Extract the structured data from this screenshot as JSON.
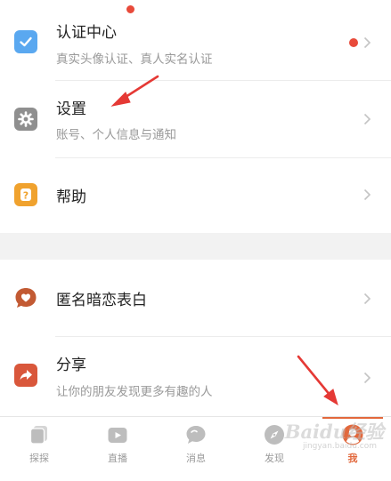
{
  "colors": {
    "accent": "#e2683c",
    "badge_red": "#e84a3a",
    "annotation_red": "#e53935"
  },
  "menu": {
    "certification": {
      "title": "认证中心",
      "subtitle": "真实头像认证、真人实名认证",
      "icon": "checkbox-icon"
    },
    "settings": {
      "title": "设置",
      "subtitle": "账号、个人信息与通知",
      "icon": "gear-icon"
    },
    "help": {
      "title": "帮助",
      "icon": "question-icon"
    },
    "anonymous_confession": {
      "title": "匿名暗恋表白",
      "icon": "heart-bubble-icon"
    },
    "share": {
      "title": "分享",
      "subtitle": "让你的朋友发现更多有趣的人",
      "icon": "share-icon"
    }
  },
  "tabbar": {
    "items": [
      {
        "label": "探探",
        "icon": "cards-icon"
      },
      {
        "label": "直播",
        "icon": "tv-icon"
      },
      {
        "label": "消息",
        "icon": "chat-icon"
      },
      {
        "label": "发现",
        "icon": "compass-icon"
      },
      {
        "label": "我",
        "icon": "profile-icon",
        "active": true
      }
    ]
  },
  "watermark": {
    "text": "Baidu经验",
    "url_text": "jingyan.baidu.com"
  }
}
